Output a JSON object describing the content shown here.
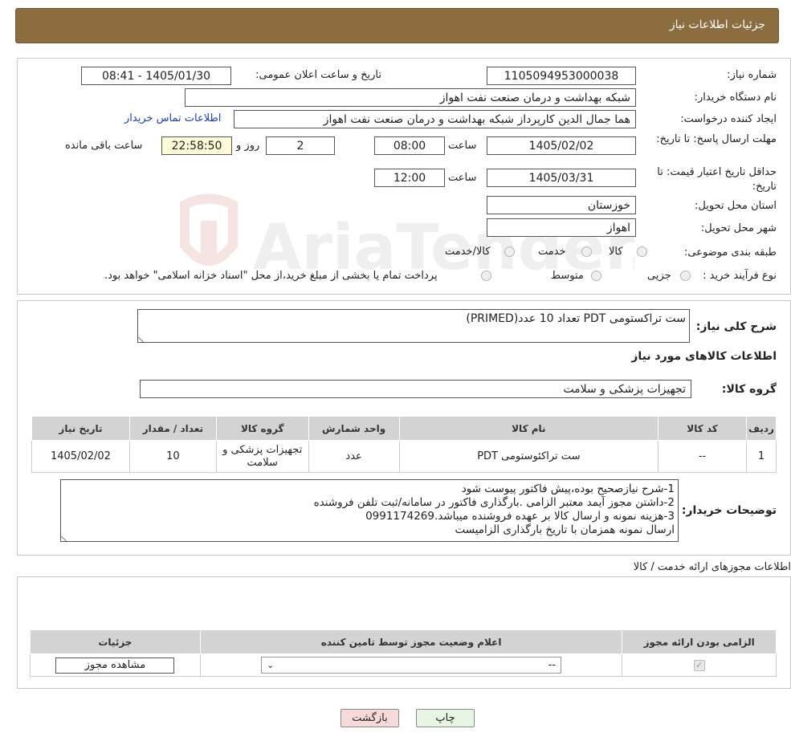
{
  "header": {
    "title": "جزئیات اطلاعات نیاز"
  },
  "fields": {
    "need_number_label": "شماره نیاز:",
    "need_number": "1105094953000038",
    "announce_label": "تاریخ و ساعت اعلان عمومی:",
    "announce_value": "1405/01/30 - 08:41",
    "buyer_org_label": "نام دستگاه خریدار:",
    "buyer_org": "شبکه بهداشت و درمان صنعت نفت اهواز",
    "creator_label": "ایجاد کننده درخواست:",
    "creator": "هما جمال الدین کارپرداز شبکه بهداشت و درمان صنعت نفت اهواز",
    "contact_link": "اطلاعات تماس خریدار",
    "deadline_label": "مهلت ارسال پاسخ: تا تاریخ:",
    "deadline_date": "1405/02/02",
    "time_label": "ساعت",
    "deadline_time": "08:00",
    "days_value": "2",
    "days_label": "روز و",
    "remaining_value": "22:58:50",
    "remaining_label": "ساعت باقی مانده",
    "validity_label": "حداقل تاریخ اعتبار قیمت: تا تاریخ:",
    "validity_date": "1405/03/31",
    "validity_time": "12:00",
    "province_label": "استان محل تحویل:",
    "province": "خوزستان",
    "city_label": "شهر محل تحویل:",
    "city": "اهواز",
    "category_label": "طبقه بندی موضوعی:",
    "category_options": [
      "کالا",
      "خدمت",
      "کالا/خدمت"
    ],
    "process_label": "نوع فرآیند خرید :",
    "process_options": [
      "جزیی",
      "متوسط"
    ],
    "process_note": "پرداخت تمام یا بخشی از مبلغ خرید،از محل \"اسناد خزانه اسلامی\" خواهد بود."
  },
  "description": {
    "label": "شرح کلی نیاز:",
    "value": "ست تراکستومی PDT تعداد 10 عدد(PRIMED)"
  },
  "goods_section_title": "اطلاعات کالاهای مورد نیاز",
  "goods_group": {
    "label": "گروه کالا:",
    "value": "تجهیزات پزشکی و سلامت"
  },
  "goods_table": {
    "headers": [
      "ردیف",
      "کد کالا",
      "نام کالا",
      "واحد شمارش",
      "گروه کالا",
      "تعداد / مقدار",
      "تاریخ نیاز"
    ],
    "rows": [
      [
        "1",
        "--",
        "ست تراکئوستومی PDT",
        "عدد",
        "تجهیزات پزشکی و سلامت",
        "10",
        "1405/02/02"
      ]
    ]
  },
  "buyer_notes": {
    "label": "توضیحات خریدار:",
    "lines": [
      "1-شرح نیازصحیح بوده،پیش فاکتور  پیوست شود",
      "2-داشتن مجوز آیمد معتبر الزامی  .بارگذاری فاکتور در سامانه/ثبت تلفن فروشنده",
      "3-هزینه نمونه و ارسال کالا بر عهده فروشنده میباشد.0991174269",
      "ارسال نمونه همزمان با تاریخ بارگذاری الزامیست"
    ]
  },
  "license_section_title": "اطلاعات مجوزهای ارائه خدمت / کالا",
  "license_table": {
    "headers": [
      "الزامی بودن ارائه مجوز",
      "اعلام وضعیت مجوز توسط تامین کننده",
      "جزئیات"
    ],
    "select_value": "--",
    "view_button": "مشاهده مجوز"
  },
  "buttons": {
    "print": "چاپ",
    "back": "بازگشت"
  },
  "watermark": "AriaTender.neT",
  "colors": {
    "header_bg": "#8b6d40",
    "remaining_bg": "#fefcd8",
    "back_btn_bg": "#f9dada",
    "print_btn_bg": "#e6f6e2",
    "link": "#1a3ec6"
  }
}
